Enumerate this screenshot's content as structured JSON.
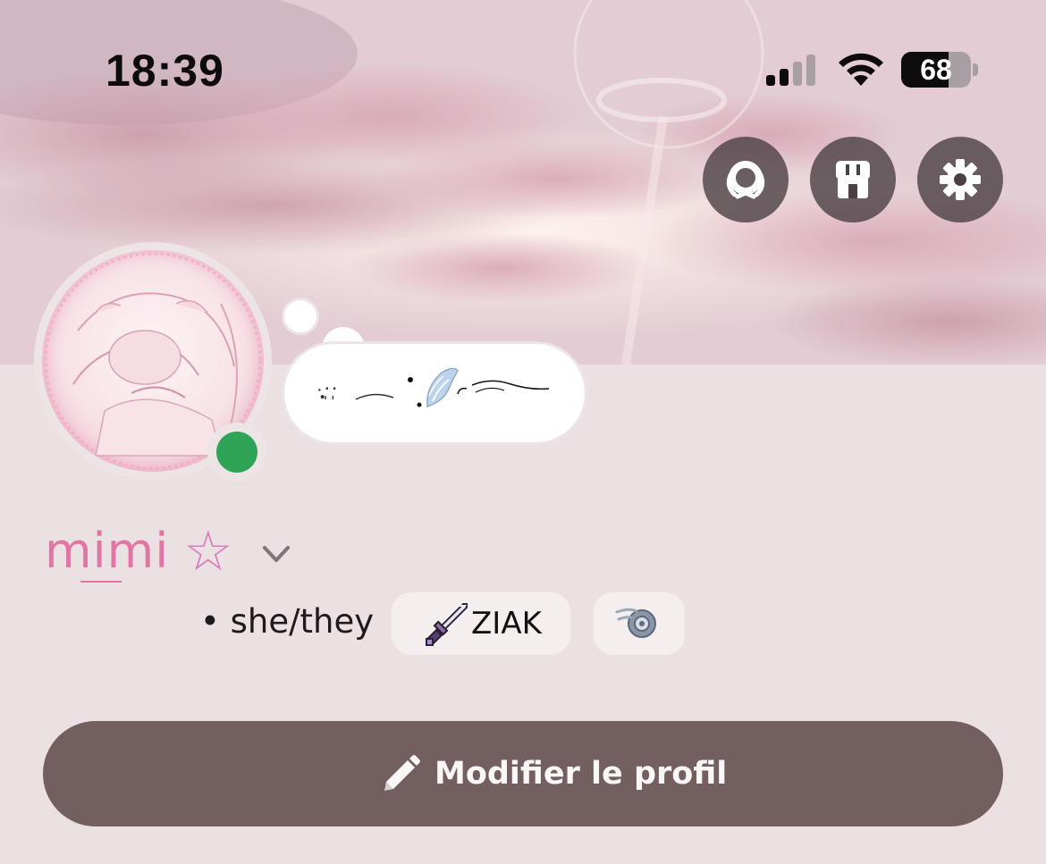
{
  "status_bar": {
    "time": "18:39",
    "battery_level": 68,
    "battery_text": "68",
    "signal_bars_active": 2,
    "signal_bars_total": 4
  },
  "header_actions": [
    {
      "name": "wreath-icon",
      "label": "Nitro badge"
    },
    {
      "name": "shop-icon",
      "label": "Shop"
    },
    {
      "name": "gear-icon",
      "label": "Settings"
    }
  ],
  "profile": {
    "display_name": "mimi",
    "name_decoration": "☆",
    "online_status": "online",
    "status_color": "#2fa456",
    "bubble_text": "·̩̩̥͙·̩·̩",
    "pronouns": "• she/they",
    "clan_tag": "ZIAK",
    "clan_icon": "sword-icon",
    "badge_icon": "quest-badge-icon"
  },
  "actions": {
    "edit_profile_label": "Modifier le profil"
  },
  "colors": {
    "background": "#ebe1e3",
    "accent_name": "#e276a2",
    "edit_button": "#735e60",
    "chip": "#f4eeef"
  }
}
